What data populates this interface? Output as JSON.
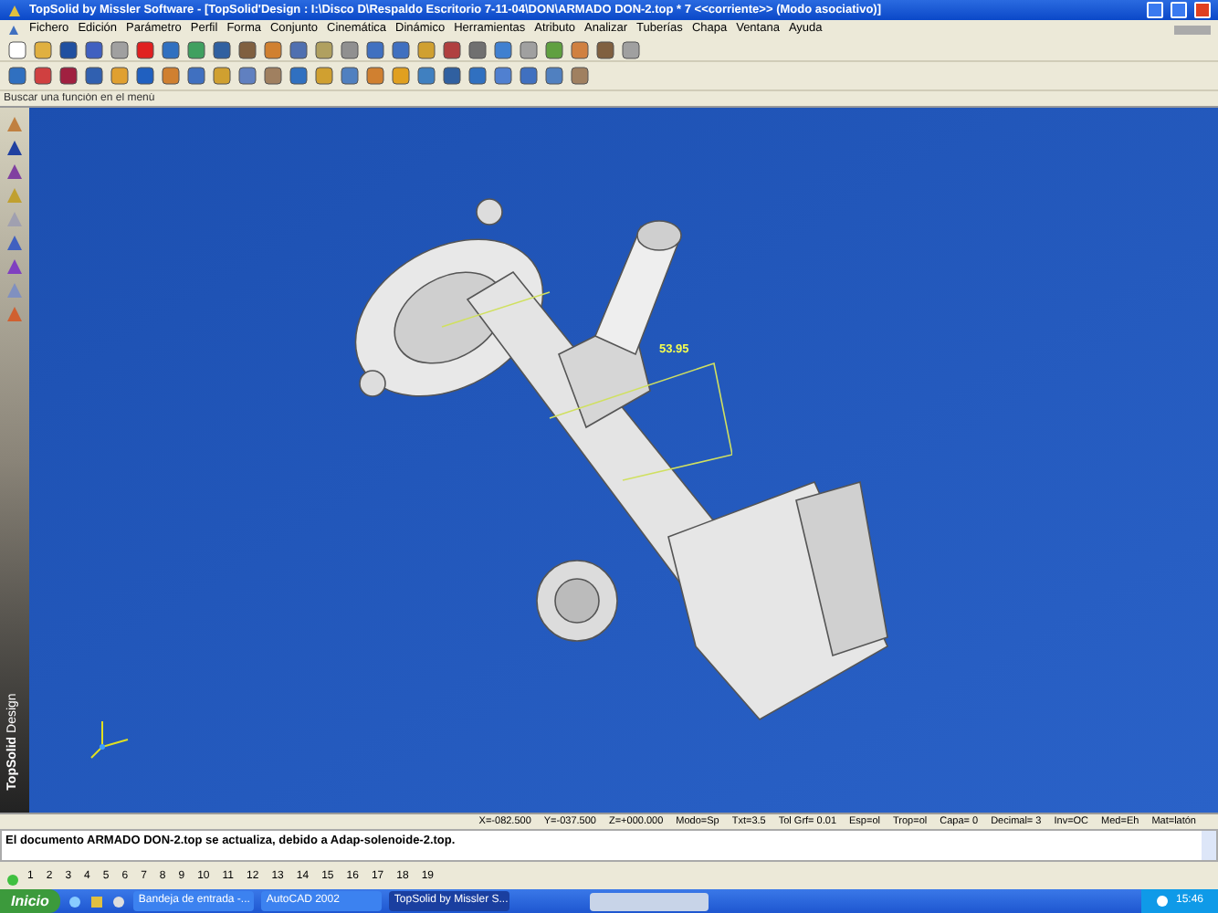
{
  "window": {
    "title": "TopSolid by Missler Software - [TopSolid'Design : I:\\Disco D\\Respaldo Escritorio 7-11-04\\DON\\ARMADO DON-2.top * 7  <<corriente>> (Modo asociativo)]"
  },
  "menu": [
    "Fichero",
    "Edición",
    "Parámetro",
    "Perfil",
    "Forma",
    "Conjunto",
    "Cinemática",
    "Dinámico",
    "Herramientas",
    "Atributo",
    "Analizar",
    "Tuberías",
    "Chapa",
    "Ventana",
    "Ayuda"
  ],
  "search": {
    "placeholder": "Buscar una función en el menú"
  },
  "side_brand": {
    "bold": "TopSolid",
    "light": "Design"
  },
  "viewport": {
    "dimension": "53.95"
  },
  "status_bar": [
    "X=-082.500",
    "Y=-037.500",
    "Z=+000.000",
    "Modo=Sp",
    "Txt=3.5",
    "Tol Grf= 0.01",
    "Esp=ol",
    "Trop=ol",
    "Capa= 0",
    "Decimal= 3",
    "Inv=OC",
    "Med=Eh",
    "Mat=latón"
  ],
  "message": "El documento ARMADO DON-2.top se actualiza, debido a Adap-solenoide-2.top.",
  "layer_tabs": [
    {
      "label": "1",
      "selected": false
    },
    {
      "label": "2",
      "selected": false
    },
    {
      "label": "3",
      "selected": false
    },
    {
      "label": "4",
      "selected": false
    },
    {
      "label": "5",
      "selected": false
    },
    {
      "label": "6",
      "selected": false
    },
    {
      "label": "7",
      "selected": false
    },
    {
      "label": "8",
      "selected": false
    },
    {
      "label": "9",
      "selected": false
    },
    {
      "label": "10",
      "selected": false
    },
    {
      "label": "11",
      "selected": false
    },
    {
      "label": "12",
      "selected": false
    },
    {
      "label": "13",
      "selected": false
    },
    {
      "label": "14",
      "selected": false
    },
    {
      "label": "15",
      "selected": false
    },
    {
      "label": "16",
      "selected": false
    },
    {
      "label": "17",
      "selected": false
    },
    {
      "label": "18",
      "selected": false
    },
    {
      "label": "19",
      "selected": false
    }
  ],
  "taskbar": {
    "start": "Inicio",
    "tasks": [
      {
        "label": "Bandeja de entrada -...",
        "selected": false
      },
      {
        "label": "AutoCAD 2002",
        "selected": false
      },
      {
        "label": "TopSolid by Missler S...",
        "selected": true
      }
    ],
    "clock": "15:46"
  }
}
